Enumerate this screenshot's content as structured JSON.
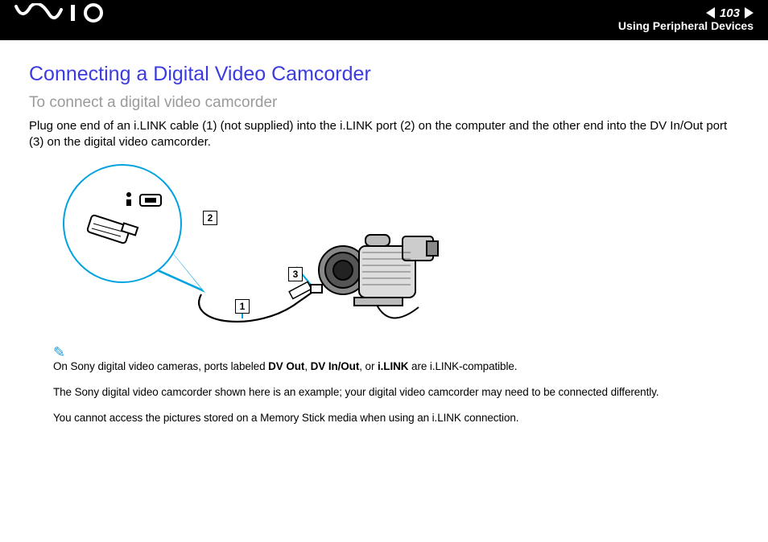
{
  "header": {
    "page_number": "103",
    "section": "Using Peripheral Devices"
  },
  "title": "Connecting a Digital Video Camcorder",
  "subtitle": "To connect a digital video camcorder",
  "body": "Plug one end of an i.LINK cable (1) (not supplied) into the i.LINK port (2) on the computer and the other end into the DV In/Out port (3) on the digital video camcorder.",
  "figure": {
    "label_1": "1",
    "label_2": "2",
    "label_3": "3"
  },
  "notes": {
    "line1_pre": "On Sony digital video cameras, ports labeled ",
    "line1_b1": "DV Out",
    "line1_sep1": ", ",
    "line1_b2": "DV In/Out",
    "line1_sep2": ", or ",
    "line1_b3": "i.LINK",
    "line1_post": " are i.LINK-compatible.",
    "line2": "The Sony digital video camcorder shown here is an example; your digital video camcorder may need to be connected differently.",
    "line3": "You cannot access the pictures stored on a Memory Stick media when using an i.LINK connection."
  }
}
